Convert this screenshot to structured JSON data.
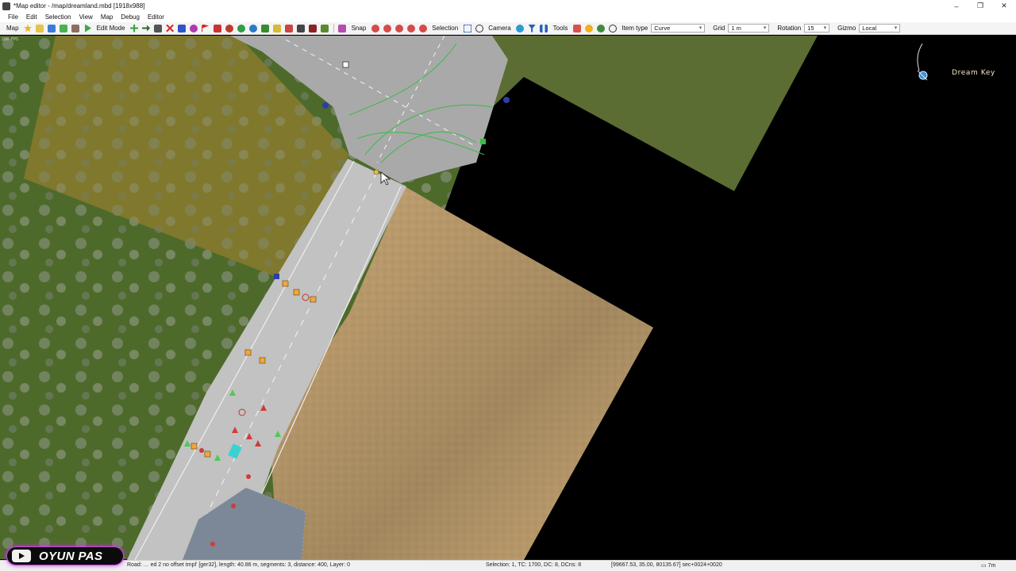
{
  "window": {
    "title": "*Map editor - /map/dreamland.mbd [1918x988]",
    "minimize": "–",
    "maximize": "❐",
    "close": "✕"
  },
  "menu": [
    "File",
    "Edit",
    "Selection",
    "View",
    "Map",
    "Debug",
    "Editor"
  ],
  "toolbar": {
    "map_label": "Map",
    "edit_mode_label": "Edit Mode",
    "snap_label": "Snap",
    "selection_label": "Selection",
    "camera_label": "Camera",
    "tools_label": "Tools",
    "item_type_label": "Item type",
    "item_type_value": "Curve",
    "grid_label": "Grid",
    "grid_value": "1 m",
    "rotation_label": "Rotation",
    "rotation_value": "15",
    "gizmo_label": "Gizmo",
    "gizmo_value": "Local",
    "icons": [
      "star-icon",
      "open-folder-icon",
      "save-icon",
      "export-icon",
      "import-icon",
      "play-icon",
      "add-icon",
      "forward-icon",
      "swap-icon",
      "delete-icon",
      "help-icon",
      "search-icon",
      "flag-icon",
      "rotate-icon",
      "refresh-icon",
      "pin-icon",
      "tree-icon",
      "grid-icon",
      "truck-icon",
      "people-icon",
      "terrain-icon",
      "filter-icon",
      "pause-icon",
      "settings-icon",
      "zoom-icon"
    ]
  },
  "viewport": {
    "fps_text": "200 FPS",
    "overlay_label": "Dream Key"
  },
  "status": {
    "left": "Road: … ed 2 no offset tmpl' [ger32], length: 40.86 m, segments: 3, distance: 400, Layer: 0",
    "selection": "Selection: 1, TC: 1700, DC: 8, DCns: 8",
    "coords": "[99667.53, 35.00, 80135.67] sec+0024+0020",
    "zoom": "7m"
  },
  "watermark": {
    "text": "OYUN PAS"
  },
  "colors": {
    "grass": "#4f6b2a",
    "field": "#8a7a2c",
    "road": "#b6b6b6",
    "sand": "#c9a877",
    "accent_node": "#2e8b2e",
    "watermark_border": "#d23df0"
  }
}
